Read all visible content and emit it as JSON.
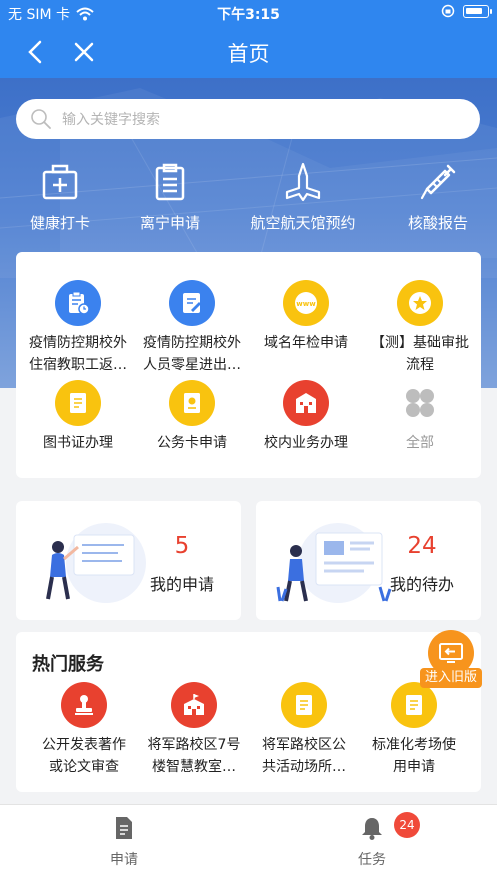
{
  "status_bar": {
    "carrier": "无 SIM 卡",
    "time": "下午3:15"
  },
  "nav": {
    "title": "首页",
    "back_icon": "back-chevron-icon",
    "close_icon": "close-icon"
  },
  "search": {
    "placeholder": "输入关键字搜索",
    "icon": "search-icon"
  },
  "quick_actions": [
    {
      "label": "健康打卡",
      "icon": "medical-kit-icon"
    },
    {
      "label": "离宁申请",
      "icon": "clipboard-icon"
    },
    {
      "label": "航空航天馆预约",
      "icon": "airplane-icon"
    },
    {
      "label": "核酸报告",
      "icon": "syringe-icon"
    }
  ],
  "apps": [
    {
      "label_line1": "疫情防控期校外",
      "label_line2": "住宿教职工返…",
      "icon": "clipboard-clock-icon",
      "color": "#3b82ee"
    },
    {
      "label_line1": "疫情防控期校外",
      "label_line2": "人员零星进出…",
      "icon": "document-edit-icon",
      "color": "#3b82ee"
    },
    {
      "label_line1": "域名年检申请",
      "label_line2": "",
      "icon": "www-globe-icon",
      "color": "#f9c30f"
    },
    {
      "label_line1": "【测】基础审批",
      "label_line2": "流程",
      "icon": "star-badge-icon",
      "color": "#f9c30f"
    },
    {
      "label_line1": "图书证办理",
      "label_line2": "",
      "icon": "book-card-icon",
      "color": "#f9c30f"
    },
    {
      "label_line1": "公务卡申请",
      "label_line2": "",
      "icon": "card-icon",
      "color": "#f9c30f"
    },
    {
      "label_line1": "校内业务办理",
      "label_line2": "",
      "icon": "building-icon",
      "color": "#e8412f"
    },
    {
      "label_line1": "全部",
      "label_line2": "",
      "icon": "all-apps-icon",
      "color": "#bdbdbd"
    }
  ],
  "stats": [
    {
      "value": "5",
      "label": "我的申请",
      "illustration": "person-application-illustration"
    },
    {
      "value": "24",
      "label": "我的待办",
      "illustration": "person-dashboard-illustration"
    }
  ],
  "hot_services": {
    "title": "热门服务",
    "items": [
      {
        "label_line1": "公开发表著作",
        "label_line2": "或论文审查",
        "icon": "stamp-icon",
        "color": "#e8412f"
      },
      {
        "label_line1": "将军路校区7号",
        "label_line2": "楼智慧教室…",
        "icon": "building-flag-icon",
        "color": "#e8412f"
      },
      {
        "label_line1": "将军路校区公",
        "label_line2": "共活动场所…",
        "icon": "document-icon",
        "color": "#f9c30f"
      },
      {
        "label_line1": "标准化考场使",
        "label_line2": "用申请",
        "icon": "document-icon",
        "color": "#f9c30f"
      }
    ]
  },
  "old_version_button": {
    "label": "进入旧版",
    "icon": "screen-back-icon"
  },
  "tabs": [
    {
      "label": "申请",
      "icon": "document-tab-icon"
    },
    {
      "label": "任务",
      "icon": "bell-icon",
      "badge": "24"
    }
  ],
  "colors": {
    "primary": "#2f86ef",
    "red": "#e8412f",
    "yellow": "#f9c30f",
    "orange": "#f7941d"
  }
}
